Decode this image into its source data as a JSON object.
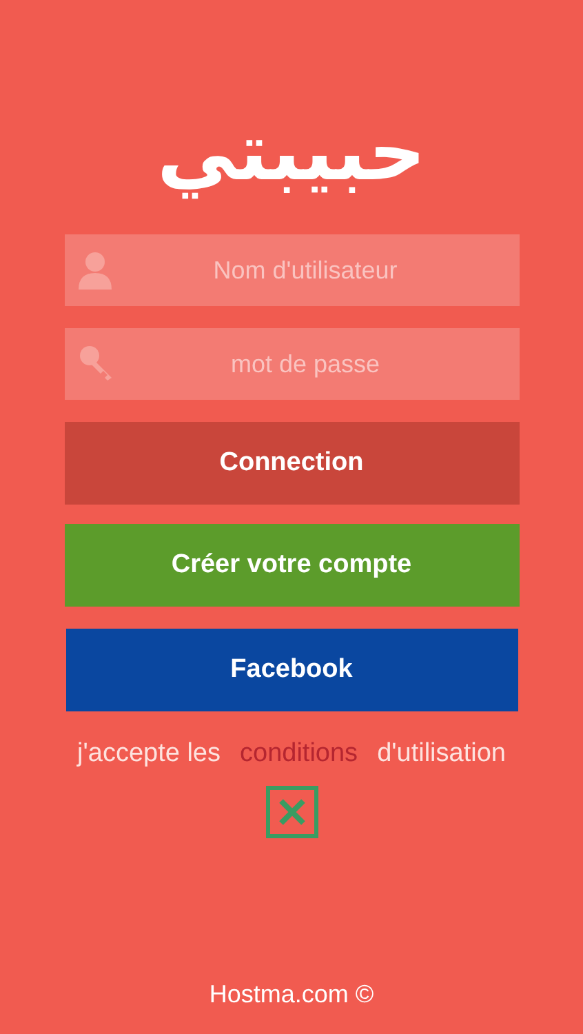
{
  "logo": "حبيبتي",
  "fields": [
    {
      "kind": "user",
      "placeholder": "Nom d'utilisateur"
    },
    {
      "kind": "password",
      "placeholder": "mot de passe"
    }
  ],
  "buttons": [
    {
      "kind": "login",
      "label": "Connection"
    },
    {
      "kind": "signup",
      "label": "Créer votre compte"
    },
    {
      "kind": "facebook",
      "label": "Facebook"
    }
  ],
  "terms": {
    "before": "j'accepte les",
    "link": "conditions",
    "after": "d'utilisation",
    "checked": true
  },
  "footer": "Hostma.com ©"
}
